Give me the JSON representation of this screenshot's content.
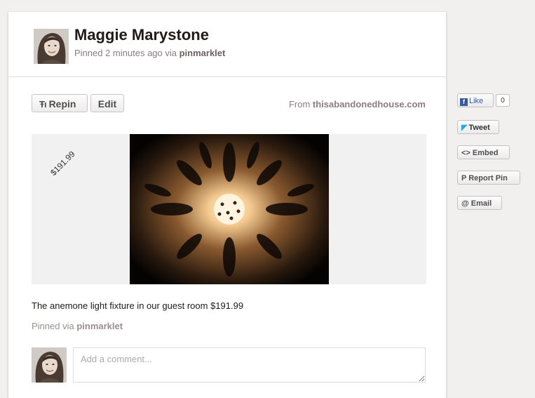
{
  "pin": {
    "user_name": "Maggie Marystone",
    "pinned_prefix": "Pinned 2 minutes ago via ",
    "pinned_source": "pinmarklet",
    "repin_label": "Repin",
    "edit_label": "Edit",
    "from_prefix": "From ",
    "from_domain": "thisabandonedhouse.com",
    "price_tag": "$191.99",
    "description": "The anemone light fixture in our guest room $191.99",
    "pinned_via_prefix": "Pinned via ",
    "pinned_via_source": "pinmarklet",
    "comment_placeholder": "Add a comment..."
  },
  "sidebar": {
    "like_label": "Like",
    "like_count": "0",
    "tweet_label": "Tweet",
    "embed_label": "Embed",
    "report_label": "Report Pin",
    "email_label": "Email"
  },
  "icons": {
    "repin": "repin-icon",
    "facebook": "facebook-icon",
    "twitter": "twitter-bird-icon",
    "embed": "embed-code-icon",
    "pinterest": "pinterest-p-icon",
    "email": "at-sign-icon"
  },
  "colors": {
    "facebook_blue": "#3b5998",
    "twitter_blue": "#2aa9e0",
    "muted_text": "#8c7e7e"
  }
}
